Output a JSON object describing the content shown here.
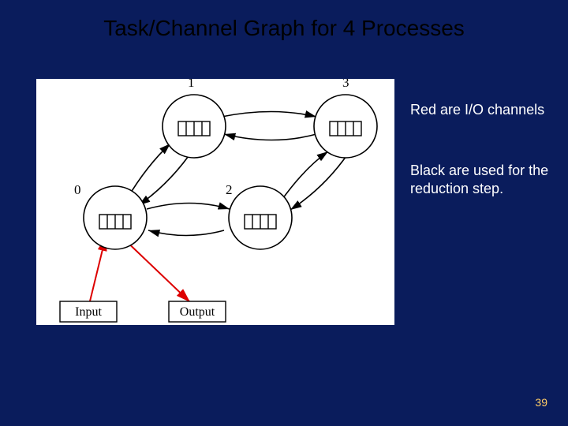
{
  "title": "Task/Channel Graph for 4 Processes",
  "annotations": {
    "red": "Red are I/O channels",
    "black": "Black are used for the reduction step."
  },
  "nodes": {
    "n0": "0",
    "n1": "1",
    "n2": "2",
    "n3": "3",
    "input": "Input",
    "output": "Output"
  },
  "page_number": "39"
}
